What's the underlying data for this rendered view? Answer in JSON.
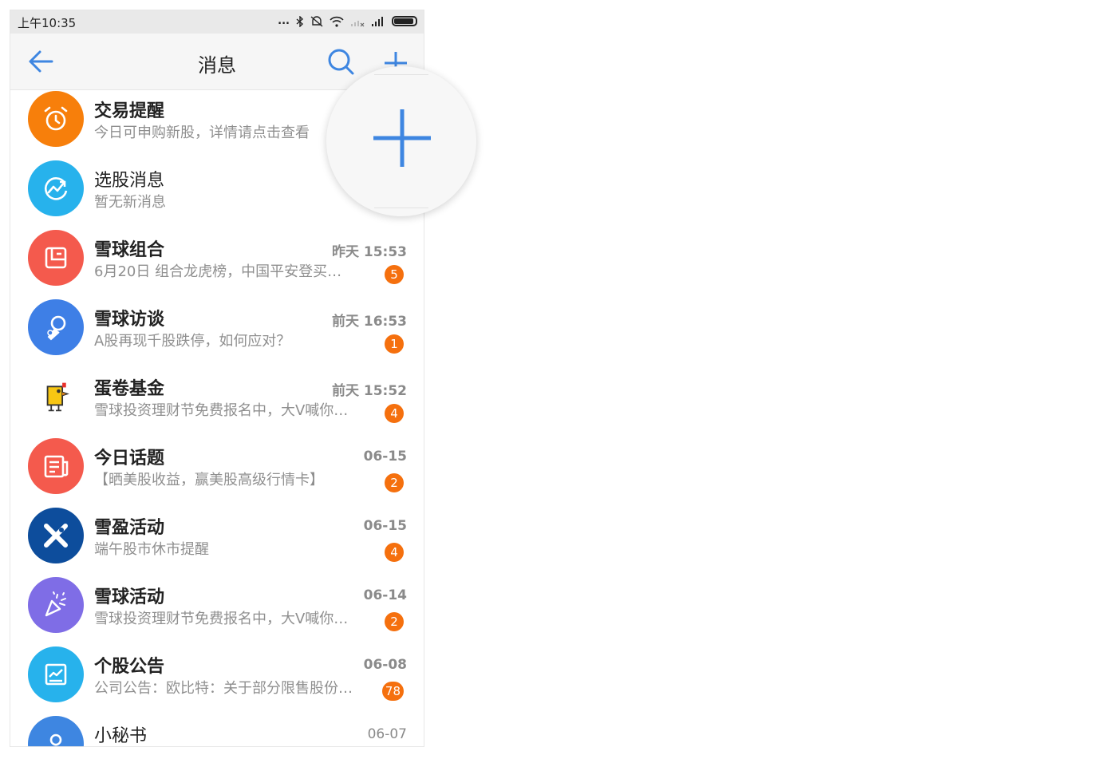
{
  "status_bar": {
    "time": "上午10:35",
    "dots": "..."
  },
  "header": {
    "title": "消息"
  },
  "colors": {
    "accent": "#3e86e1",
    "badge": "#f5700e"
  },
  "messages": [
    {
      "title": "交易提醒",
      "subtitle": "今日可申购新股，详情请点击查看",
      "time": "",
      "badge": "",
      "icon": "alarm-clock-icon",
      "color": "#f77f0b"
    },
    {
      "title": "选股消息",
      "subtitle": "暂无新消息",
      "time": "",
      "badge": "",
      "icon": "trend-chart-icon",
      "color": "#27b2ec"
    },
    {
      "title": "雪球组合",
      "subtitle": "6月20日 组合龙虎榜，中国平安登买…",
      "time": "昨天 15:53",
      "badge": "5",
      "icon": "portfolio-icon",
      "color": "#f45a4d"
    },
    {
      "title": "雪球访谈",
      "subtitle": "A股再现千股跌停，如何应对？",
      "time": "前天 16:53",
      "badge": "1",
      "icon": "microphone-icon",
      "color": "#3e7fe6"
    },
    {
      "title": "蛋卷基金",
      "subtitle": "雪球投资理财节免费报名中，大V喊你…",
      "time": "前天 15:52",
      "badge": "4",
      "icon": "chick-mascot-icon",
      "color": "#ffffff"
    },
    {
      "title": "今日话题",
      "subtitle": "【晒美股收益，赢美股高级行情卡】",
      "time": "06-15",
      "badge": "2",
      "icon": "newspaper-icon",
      "color": "#f45a4d"
    },
    {
      "title": "雪盈活动",
      "subtitle": "端午股市休市提醒",
      "time": "06-15",
      "badge": "4",
      "icon": "x-logo-icon",
      "color": "#0d4d9c"
    },
    {
      "title": "雪球活动",
      "subtitle": "雪球投资理财节免费报名中，大V喊你…",
      "time": "06-14",
      "badge": "2",
      "icon": "party-popper-icon",
      "color": "#7f6de6"
    },
    {
      "title": "个股公告",
      "subtitle": "公司公告：欧比特：关于部分限售股份…",
      "time": "06-08",
      "badge": "78",
      "icon": "report-chart-icon",
      "color": "#27b2ec"
    },
    {
      "title": "小秘书",
      "subtitle": "",
      "time": "06-07",
      "badge": "",
      "icon": "assistant-icon",
      "color": "#3e86e1"
    }
  ]
}
